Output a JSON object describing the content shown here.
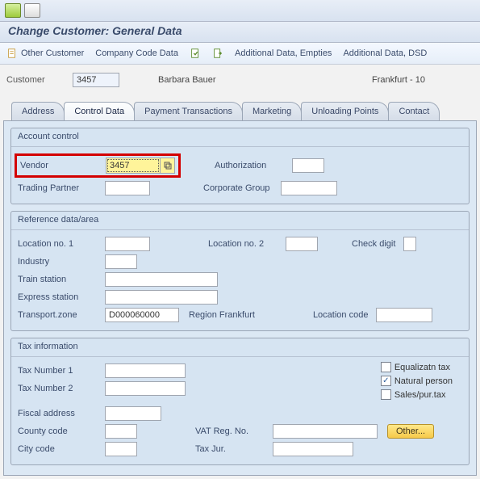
{
  "title": "Change Customer: General Data",
  "toolbar": {
    "other_customer": "Other Customer",
    "company_code_data": "Company Code Data",
    "additional_empties": "Additional Data, Empties",
    "additional_dsd": "Additional Data, DSD"
  },
  "customer": {
    "label": "Customer",
    "number": "3457",
    "name": "Barbara Bauer",
    "city": "Frankfurt - 10"
  },
  "tabs": {
    "address": "Address",
    "control_data": "Control Data",
    "payment": "Payment Transactions",
    "marketing": "Marketing",
    "unloading": "Unloading Points",
    "contact": "Contact"
  },
  "account_control": {
    "title": "Account control",
    "vendor_label": "Vendor",
    "vendor_value": "3457",
    "authorization_label": "Authorization",
    "authorization_value": "",
    "trading_partner_label": "Trading Partner",
    "trading_partner_value": "",
    "corporate_group_label": "Corporate Group",
    "corporate_group_value": ""
  },
  "reference": {
    "title": "Reference data/area",
    "loc1_label": "Location no. 1",
    "loc1_value": "",
    "loc2_label": "Location no. 2",
    "loc2_value": "",
    "check_digit_label": "Check digit",
    "check_digit_value": "",
    "industry_label": "Industry",
    "industry_value": "",
    "train_label": "Train station",
    "train_value": "",
    "express_label": "Express station",
    "express_value": "",
    "tzone_label": "Transport.zone",
    "tzone_value": "D000060000",
    "tzone_text": "Region Frankfurt",
    "loc_code_label": "Location code",
    "loc_code_value": ""
  },
  "tax": {
    "title": "Tax information",
    "tax1_label": "Tax Number 1",
    "tax1_value": "",
    "tax2_label": "Tax Number 2",
    "tax2_value": "",
    "equal_label": "Equalizatn tax",
    "natural_label": "Natural person",
    "sales_label": "Sales/pur.tax",
    "chk_equal": false,
    "chk_natural": true,
    "chk_sales": false,
    "fiscal_label": "Fiscal address",
    "fiscal_value": "",
    "county_label": "County code",
    "county_value": "",
    "vat_label": "VAT Reg. No.",
    "vat_value": "",
    "other_btn": "Other...",
    "city_label": "City code",
    "city_value": "",
    "taxjur_label": "Tax Jur.",
    "taxjur_value": ""
  }
}
